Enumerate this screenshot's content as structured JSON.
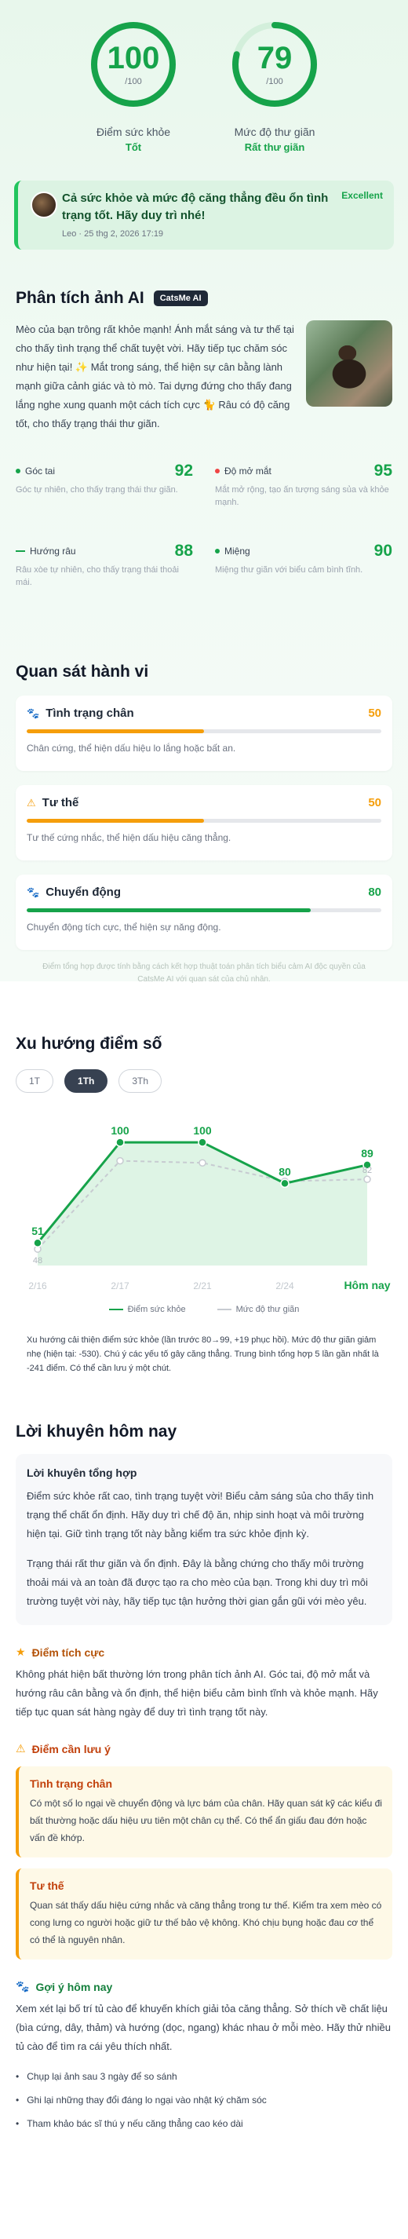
{
  "scores": [
    {
      "value": "100",
      "max": "/100",
      "label": "Điểm sức khỏe",
      "status": "Tốt",
      "fraction": 1.0
    },
    {
      "value": "79",
      "max": "/100",
      "label": "Mức độ thư giãn",
      "status": "Rất thư giãn",
      "fraction": 0.79
    }
  ],
  "banner": {
    "text": "Cả sức khỏe và mức độ căng thẳng đều ổn tình trạng tốt. Hãy duy trì nhé!",
    "meta": "Leo · 25 thg 2, 2026 17:19",
    "badge": "Excellent"
  },
  "analysis": {
    "title": "Phân tích ảnh AI",
    "badge": "CatsMe AI",
    "text": "Mèo của bạn trông rất khỏe mạnh! Ánh mắt sáng và tư thế tại cho thấy tình trạng thể chất tuyệt vời. Hãy tiếp tục chăm sóc như hiện tại! ✨ Mắt trong sáng, thể hiện sự cân bằng lành mạnh giữa cảnh giác và tò mò. Tai dựng đứng cho thấy đang lắng nghe xung quanh một cách tích cực 🐈 Râu có độ căng tốt, cho thấy trạng thái thư giãn.",
    "metrics": [
      {
        "name": "Góc tai",
        "value": "92",
        "desc": "Góc tự nhiên, cho thấy trạng thái thư giãn.",
        "color": "#16a34a"
      },
      {
        "name": "Độ mở mắt",
        "value": "95",
        "desc": "Mắt mở rộng, tạo ấn tượng sáng sủa và khỏe mạnh.",
        "color": "#ef4444"
      },
      {
        "name": "Hướng râu",
        "value": "88",
        "desc": "Râu xòe tự nhiên, cho thấy trạng thái thoải mái.",
        "color": "#16a34a"
      },
      {
        "name": "Miệng",
        "value": "90",
        "desc": "Miệng thư giãn với biểu cảm bình tĩnh.",
        "color": "#16a34a"
      }
    ]
  },
  "behavior": {
    "title": "Quan sát hành vi",
    "items": [
      {
        "name": "Tình trạng chân",
        "value": "50",
        "fraction": 0.5,
        "desc": "Chân cứng, thể hiện dấu hiệu lo lắng hoặc bất an.",
        "color": "#f59e0b",
        "icon": "paw-icon"
      },
      {
        "name": "Tư thế",
        "value": "50",
        "fraction": 0.5,
        "desc": "Tư thế cứng nhắc, thể hiện dấu hiệu căng thẳng.",
        "color": "#f59e0b",
        "icon": "warning-icon"
      },
      {
        "name": "Chuyển động",
        "value": "80",
        "fraction": 0.8,
        "desc": "Chuyển động tích cực, thể hiện sự năng động.",
        "color": "#16a34a",
        "icon": "paw-icon"
      }
    ],
    "disclaimer": "Điểm tổng hợp được tính bằng cách kết hợp thuật toán phân tích biểu cảm AI độc quyền của CatsMe AI với quan sát của chủ nhân."
  },
  "trends": {
    "title": "Xu hướng điểm số",
    "chips": [
      "1T",
      "1Th",
      "3Th"
    ],
    "active_chip": 1,
    "note": "Xu hướng cải thiện điểm sức khỏe (lần trước 80→99, +19 phục hồi). Mức độ thư giãn giảm nhẹ (hiện tại: -530). Chú ý các yếu tố gây căng thẳng. Trung bình tổng hợp 5 lần gần nhất là -241 điểm. Có thể cần lưu ý một chút."
  },
  "chart_data": {
    "type": "line",
    "categories": [
      "2/16",
      "2/17",
      "2/21",
      "2/24",
      "Hôm nay"
    ],
    "series": [
      {
        "name": "Điểm sức khỏe",
        "values": [
          51,
          100,
          100,
          80,
          89
        ],
        "color": "#16a34a"
      },
      {
        "name": "Mức độ thư giãn",
        "values": [
          48,
          91,
          90,
          81,
          82
        ],
        "color": "#c7cbd1"
      }
    ],
    "data_labels": [
      "51",
      "100",
      "100",
      "80",
      "89"
    ],
    "extra_labels": [
      "48",
      "82"
    ],
    "ylim": [
      40,
      105
    ],
    "grid": false,
    "legend_position": "bottom"
  },
  "advice": {
    "title": "Lời khuyên hôm nay",
    "overall": {
      "heading": "Lời khuyên tổng hợp",
      "p1": "Điểm sức khỏe rất cao, tình trạng tuyệt vời! Biểu cảm sáng sủa cho thấy tình trạng thể chất ổn định. Hãy duy trì chế độ ăn, nhịp sinh hoạt và môi trường hiện tại. Giữ tình trạng tốt này bằng kiểm tra sức khỏe định kỳ.",
      "p2": "Trạng thái rất thư giãn và ổn định. Đây là bằng chứng cho thấy môi trường thoải mái và an toàn đã được tạo ra cho mèo của bạn. Trong khi duy trì môi trường tuyệt vời này, hãy tiếp tục tận hưởng thời gian gắn gũi với mèo yêu."
    },
    "positive": {
      "heading": "Điểm tích cực",
      "text": "Không phát hiện bất thường lớn trong phân tích ảnh AI. Góc tai, độ mở mắt và hướng râu cân bằng và ổn định, thể hiện biểu cảm bình tĩnh và khỏe mạnh. Hãy tiếp tục quan sát hàng ngày để duy trì tình trạng tốt này."
    },
    "caution": {
      "heading": "Điểm cần lưu ý",
      "cards": [
        {
          "title": "Tình trạng chân",
          "text": "Có một số lo ngại về chuyển động và lực bám của chân. Hãy quan sát kỹ các kiểu đi bất thường hoặc dấu hiệu ưu tiên một chân cụ thể. Có thể ẩn giấu đau đớn hoặc vấn đề khớp."
        },
        {
          "title": "Tư thế",
          "text": "Quan sát thấy dấu hiệu cứng nhắc và căng thẳng trong tư thế. Kiểm tra xem mèo có cong lưng co người hoặc giữ tư thế bảo vệ không. Khó chịu bụng hoặc đau cơ thể có thể là nguyên nhân."
        }
      ]
    },
    "suggest": {
      "heading": "Gợi ý hôm nay",
      "text": "Xem xét lại bố trí tủ cào để khuyến khích giải tỏa căng thẳng. Sở thích về chất liệu (bìa cứng, dây, thảm) và hướng (dọc, ngang) khác nhau ở mỗi mèo. Hãy thử nhiều tủ cào để tìm ra cái yêu thích nhất.",
      "tips": [
        "Chụp lại ảnh sau 3 ngày để so sánh",
        "Ghi lại những thay đổi đáng lo ngại vào nhật ký chăm sóc",
        "Tham khảo bác sĩ thú y nếu căng thẳng cao kéo dài"
      ]
    }
  }
}
